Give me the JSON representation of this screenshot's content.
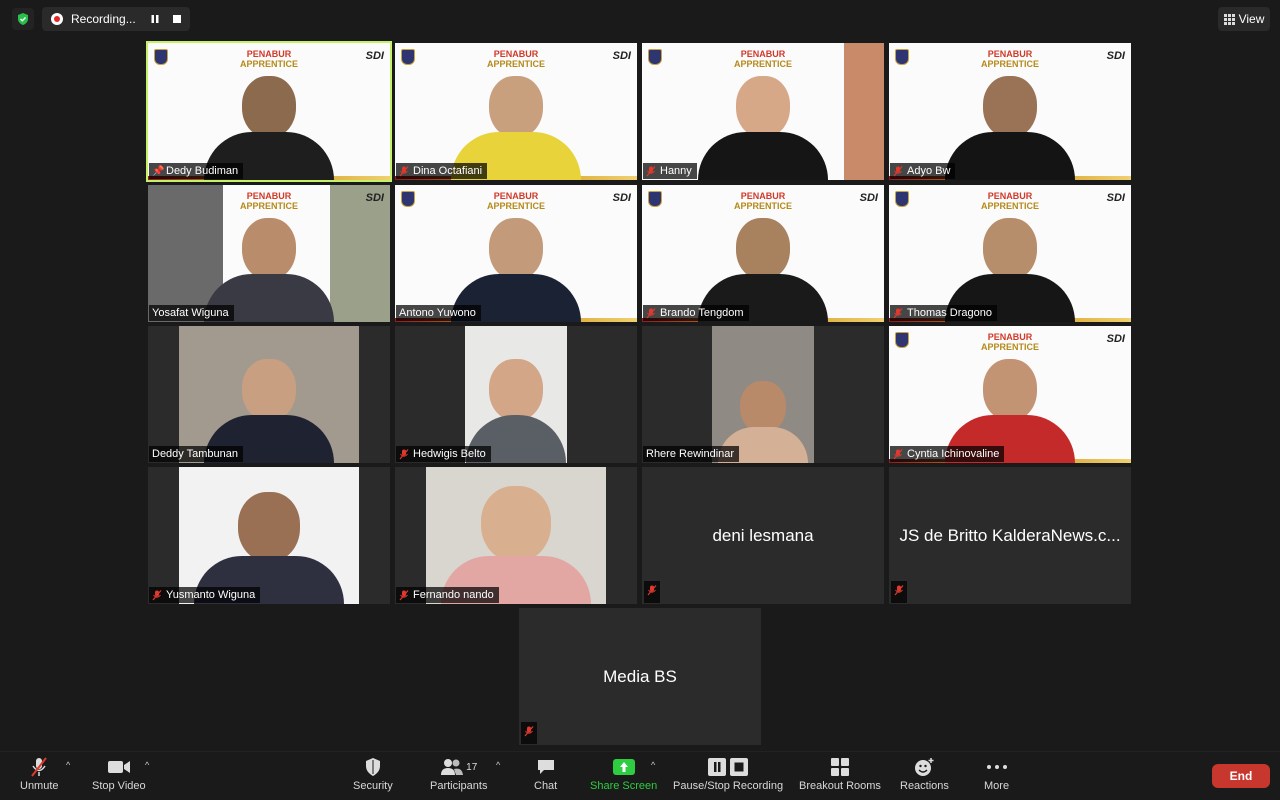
{
  "recording": {
    "label": "Recording..."
  },
  "top": {
    "view_label": "View"
  },
  "banner": {
    "line1": "PENABUR",
    "line2": "APPRENTICE",
    "sdi": "SDI"
  },
  "participants": [
    {
      "name": "Dedy Budiman"
    },
    {
      "name": "Dina Octafiani"
    },
    {
      "name": "Hanny"
    },
    {
      "name": "Adyo Bw"
    },
    {
      "name": "Yosafat Wiguna"
    },
    {
      "name": "Antono Yuwono"
    },
    {
      "name": "Brando Tengdom"
    },
    {
      "name": "Thomas Dragono"
    },
    {
      "name": "Deddy Tambunan"
    },
    {
      "name": "Hedwigis Belto"
    },
    {
      "name": "Rhere Rewindinar"
    },
    {
      "name": "Cyntia Ichinovaline"
    },
    {
      "name": "Yusmanto Wiguna"
    },
    {
      "name": "Fernando nando"
    },
    {
      "name": "deni lesmana"
    },
    {
      "name": "JS de Britto KalderaNews.c..."
    },
    {
      "name": "Media BS"
    }
  ],
  "toolbar": {
    "unmute": "Unmute",
    "stop_video": "Stop Video",
    "security": "Security",
    "participants": "Participants",
    "participants_count": "17",
    "chat": "Chat",
    "share_screen": "Share Screen",
    "pause_stop_recording": "Pause/Stop Recording",
    "breakout_rooms": "Breakout Rooms",
    "reactions": "Reactions",
    "more": "More",
    "end": "End"
  },
  "colors": {
    "active_speaker_border": "#c6ef6a",
    "share_green": "#2ecc40",
    "end_red": "#c8372d"
  }
}
